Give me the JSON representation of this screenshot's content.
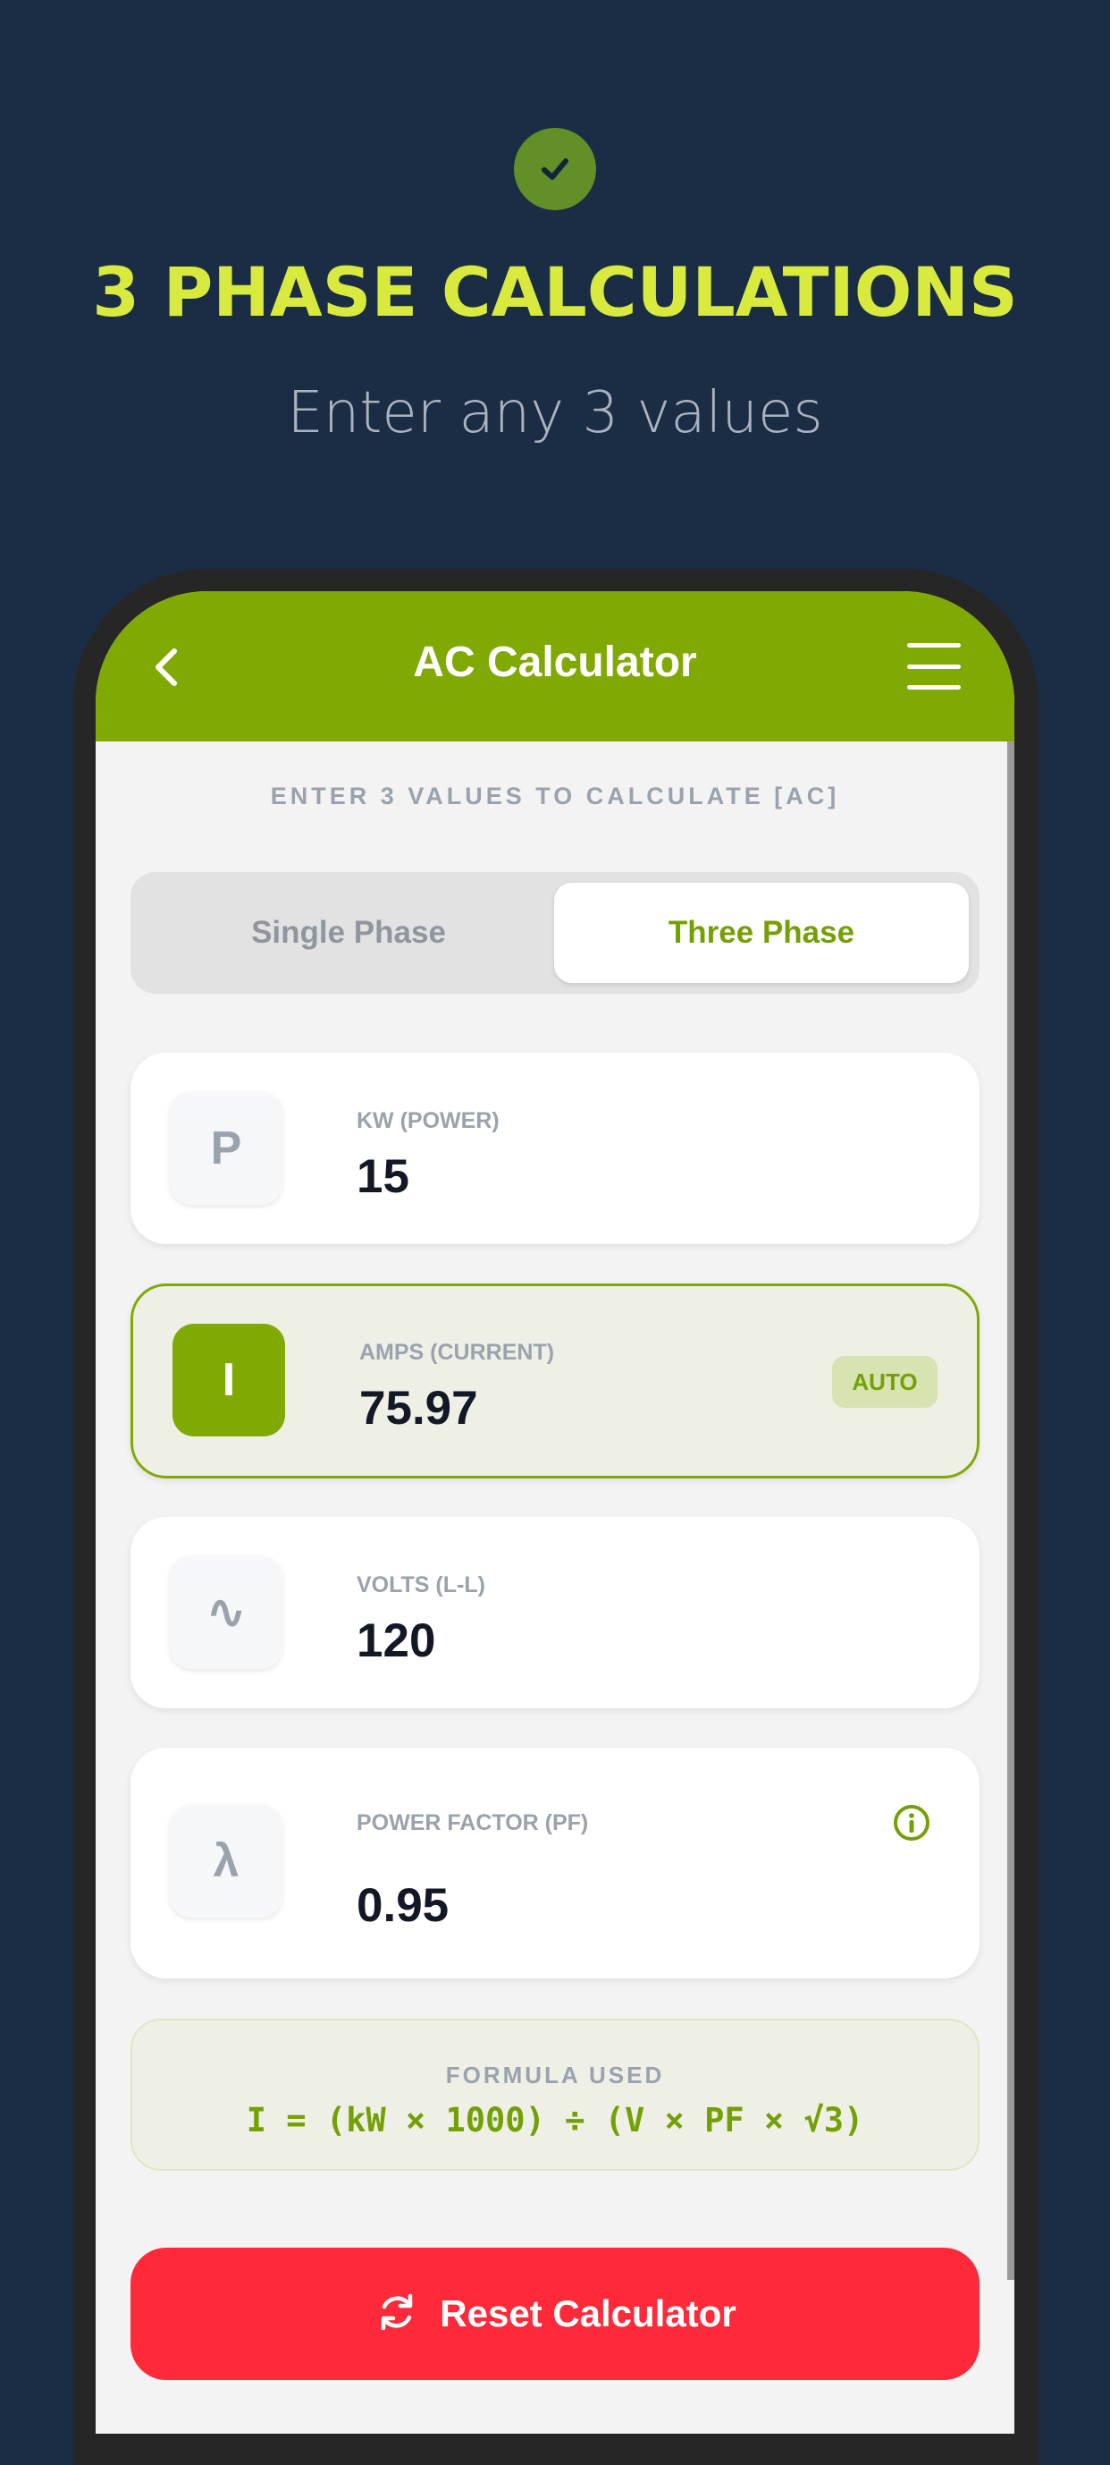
{
  "hero": {
    "title": "3 PHASE CALCULATIONS",
    "subtitle": "Enter any 3 values"
  },
  "appbar": {
    "title": "AC Calculator"
  },
  "section_label": "ENTER 3 VALUES TO CALCULATE [AC]",
  "phase_toggle": {
    "options": [
      "Single Phase",
      "Three Phase"
    ],
    "selected": "Three Phase"
  },
  "fields": [
    {
      "symbol": "P",
      "label": "KW (POWER)",
      "value": "15",
      "auto": false
    },
    {
      "symbol": "I",
      "label": "AMPS (CURRENT)",
      "value": "75.97",
      "auto": true,
      "auto_label": "AUTO"
    },
    {
      "symbol": "∿",
      "label": "VOLTS (L-L)",
      "value": "120",
      "auto": false
    },
    {
      "symbol": "λ",
      "label": "POWER FACTOR (PF)",
      "value": "0.95",
      "auto": false
    }
  ],
  "formula": {
    "title": "FORMULA USED",
    "text": "I = (kW × 1000) ÷ (V × PF × √3)"
  },
  "reset_button": {
    "label": "Reset Calculator"
  },
  "colors": {
    "background": "#1b2c45",
    "accent": "#80aa03",
    "hero_title": "#d9ea3e",
    "reset": "#fe2a39"
  },
  "icons": [
    "check-icon",
    "back-arrow-icon",
    "menu-icon",
    "info-icon",
    "refresh-icon"
  ]
}
